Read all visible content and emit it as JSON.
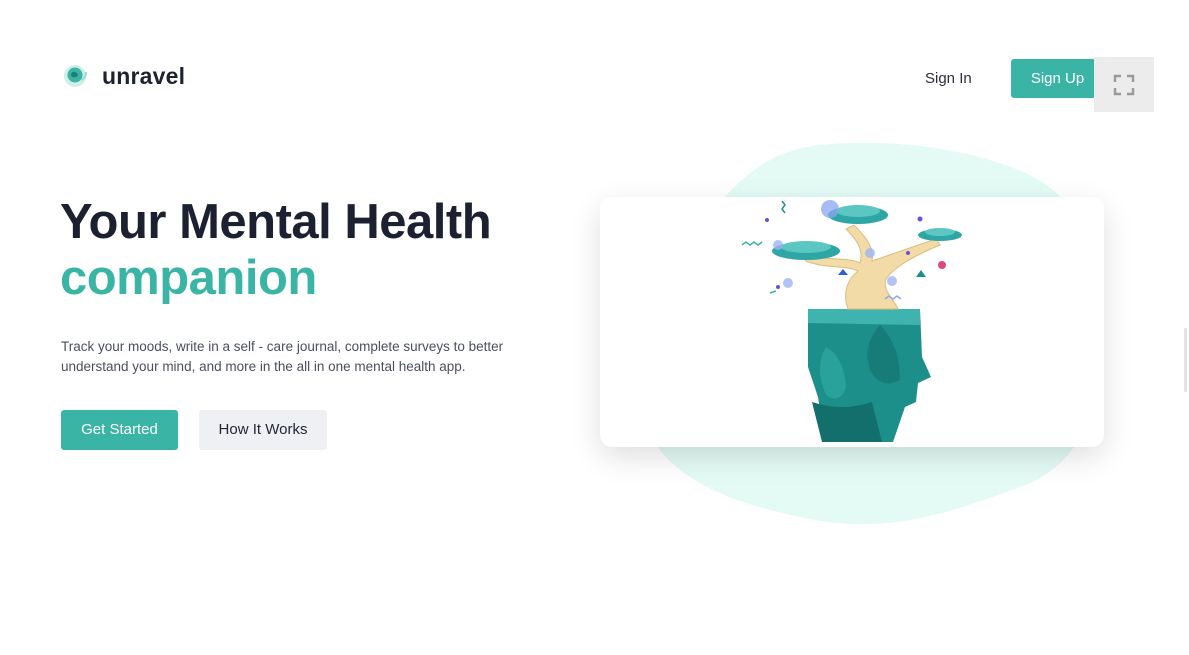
{
  "brand": {
    "name": "unravel"
  },
  "nav": {
    "sign_in": "Sign In",
    "sign_up": "Sign Up"
  },
  "hero": {
    "title": "Your Mental Health",
    "subtitle": "companion",
    "description": "Track your moods, write in a self - care journal, complete surveys to better understand your mind, and more in the all in one mental health app.",
    "cta_primary": "Get Started",
    "cta_secondary": "How It Works"
  },
  "colors": {
    "accent": "#3ab4a4",
    "blob": "#e3faf5",
    "heading": "#1b2130",
    "secondary_button_bg": "#eef0f4"
  },
  "icons": {
    "logo": "brain-head-icon",
    "fullscreen": "fullscreen-icon",
    "illustration": "tree-head-illustration"
  }
}
